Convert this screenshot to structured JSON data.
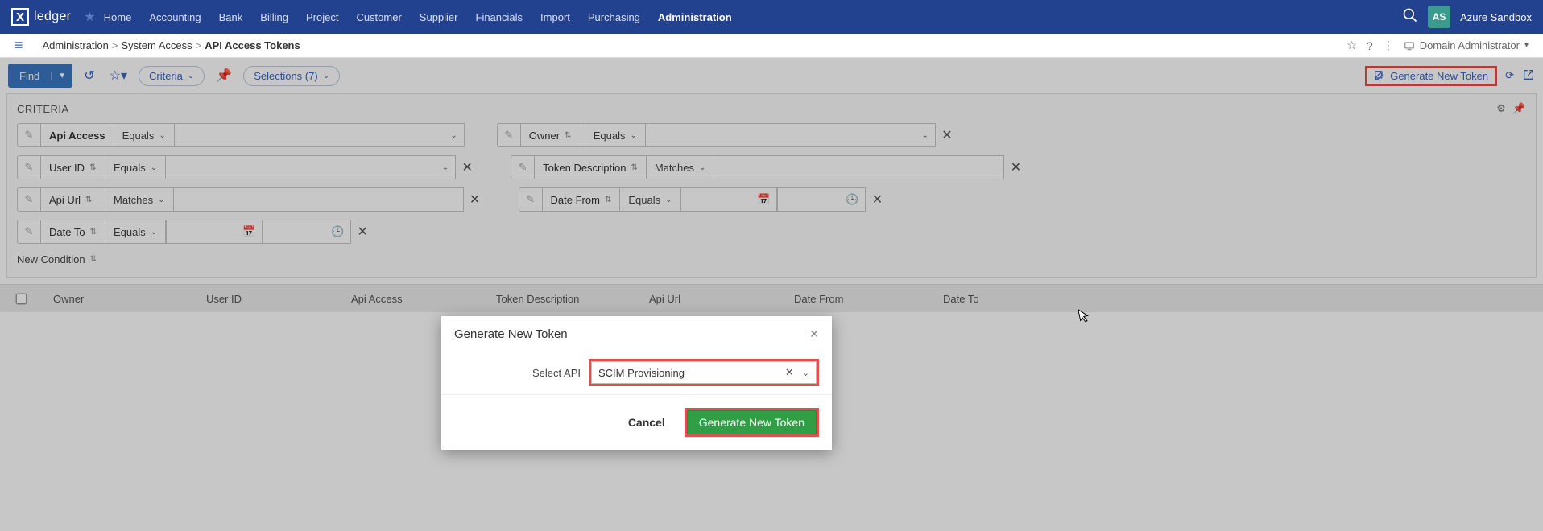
{
  "nav": {
    "logo_text": "ledger",
    "items": [
      "Home",
      "Accounting",
      "Bank",
      "Billing",
      "Project",
      "Customer",
      "Supplier",
      "Financials",
      "Import",
      "Purchasing",
      "Administration"
    ],
    "active_index": 10,
    "avatar_initials": "AS",
    "org_name": "Azure Sandbox"
  },
  "breadcrumb": {
    "items": [
      "Administration",
      "System Access",
      "API Access Tokens"
    ],
    "role_label": "Domain Administrator"
  },
  "toolbar": {
    "find_label": "Find",
    "criteria_label": "Criteria",
    "selections_label": "Selections (7)",
    "generate_label": "Generate New Token"
  },
  "criteria": {
    "title": "CRITERIA",
    "new_condition": "New Condition",
    "rows": [
      [
        {
          "label": "Api Access",
          "label_bold": true,
          "op": "Equals",
          "has_val_caret": true,
          "has_clear": false
        },
        {
          "label": "Owner",
          "label_updown": true,
          "op": "Equals",
          "has_val_caret": true,
          "has_clear": true
        }
      ],
      [
        {
          "label": "User ID",
          "label_updown": true,
          "op": "Equals",
          "has_val_caret": true,
          "has_clear": true
        },
        {
          "label": "Token Description",
          "label_updown": true,
          "op": "Matches",
          "has_val_caret": false,
          "has_clear": true
        }
      ],
      [
        {
          "label": "Api Url",
          "label_updown": true,
          "op": "Matches",
          "has_val_caret": false,
          "has_clear": true
        },
        {
          "label": "Date From",
          "label_updown": true,
          "op": "Equals",
          "is_date": true,
          "has_clear": true
        }
      ],
      [
        {
          "label": "Date To",
          "label_updown": true,
          "op": "Equals",
          "is_date": true,
          "has_clear": true
        }
      ]
    ]
  },
  "table": {
    "columns": [
      "",
      "Owner",
      "User ID",
      "Api Access",
      "Token Description",
      "Api Url",
      "Date From",
      "Date To"
    ]
  },
  "modal": {
    "title": "Generate New Token",
    "field_label": "Select API",
    "field_value": "SCIM Provisioning",
    "cancel": "Cancel",
    "submit": "Generate New Token"
  }
}
